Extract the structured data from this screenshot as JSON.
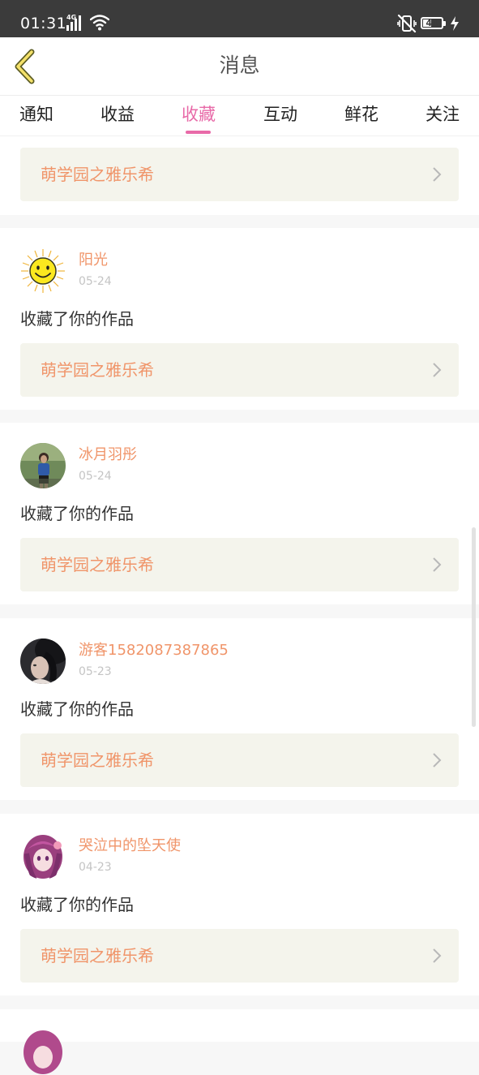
{
  "status_bar": {
    "time": "01:31",
    "network": "4G",
    "battery": "41",
    "battery_level": 0.41
  },
  "header": {
    "title": "消息",
    "back_icon": "chevron-left-icon"
  },
  "tabs": [
    {
      "label": "通知",
      "active": false
    },
    {
      "label": "收益",
      "active": false
    },
    {
      "label": "收藏",
      "active": true
    },
    {
      "label": "互动",
      "active": false
    },
    {
      "label": "鲜花",
      "active": false
    },
    {
      "label": "关注",
      "active": false
    }
  ],
  "colors": {
    "accent": "#e86aa8",
    "name": "#f0956a",
    "link_bg": "#f4f4ec",
    "date": "#c4c4c4"
  },
  "feed": {
    "partial_top": {
      "work_title": "萌学园之雅乐希"
    },
    "items": [
      {
        "username": "阳光",
        "date": "05-24",
        "action": "收藏了你的作品",
        "work_title": "萌学园之雅乐希",
        "avatar": "sun-avatar"
      },
      {
        "username": "冰月羽彤",
        "date": "05-24",
        "action": "收藏了你的作品",
        "work_title": "萌学园之雅乐希",
        "avatar": "photo-avatar"
      },
      {
        "username": "游客1582087387865",
        "date": "05-23",
        "action": "收藏了你的作品",
        "work_title": "萌学园之雅乐希",
        "avatar": "photo-avatar"
      },
      {
        "username": "哭泣中的坠天使",
        "date": "04-23",
        "action": "收藏了你的作品",
        "work_title": "萌学园之雅乐希",
        "avatar": "anime-avatar"
      }
    ]
  }
}
